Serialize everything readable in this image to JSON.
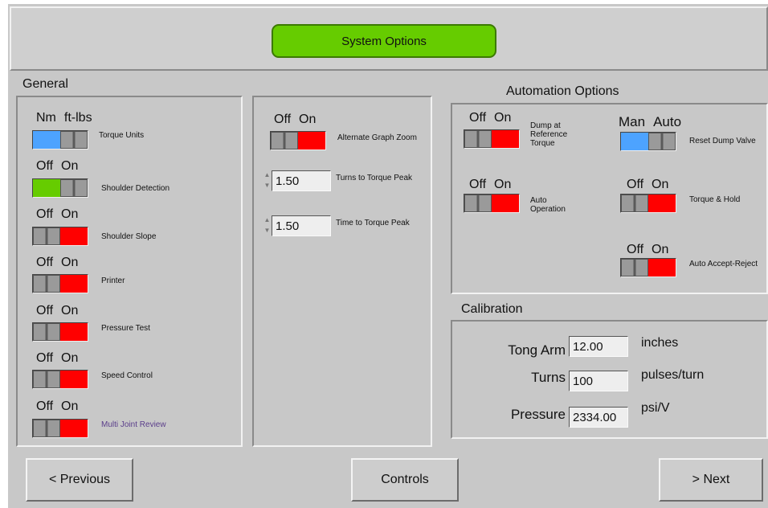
{
  "header": {
    "title": "System Options"
  },
  "general": {
    "label": "General",
    "items": [
      {
        "left": "Nm",
        "right": "ft-lbs",
        "desc": "Torque Units"
      },
      {
        "left": "Off",
        "right": "On",
        "desc": "Shoulder Detection"
      },
      {
        "left": "Off",
        "right": "On",
        "desc": "Shoulder Slope"
      },
      {
        "left": "Off",
        "right": "On",
        "desc": "Printer"
      },
      {
        "left": "Off",
        "right": "On",
        "desc": "Pressure Test"
      },
      {
        "left": "Off",
        "right": "On",
        "desc": "Speed Control"
      },
      {
        "left": "Off",
        "right": "On",
        "desc": "Multi Joint Review"
      }
    ]
  },
  "middle": {
    "zoom": {
      "left": "Off",
      "right": "On",
      "desc": "Alternate Graph Zoom"
    },
    "turns_to_torque_peak": {
      "value": "1.50",
      "label": "Turns to Torque Peak"
    },
    "time_to_torque_peak": {
      "value": "1.50",
      "label": "Time to Torque Peak"
    }
  },
  "automation": {
    "label": "Automation Options",
    "dump_at_reference": {
      "left": "Off",
      "right": "On",
      "desc": "Dump at Reference Torque"
    },
    "auto_operation": {
      "left": "Off",
      "right": "On",
      "desc": "Auto Operation"
    },
    "reset_dump_valve": {
      "left": "Man",
      "right": "Auto",
      "desc": "Reset Dump Valve"
    },
    "torque_hold": {
      "left": "Off",
      "right": "On",
      "desc": "Torque & Hold"
    },
    "auto_accept_reject": {
      "left": "Off",
      "right": "On",
      "desc": "Auto Accept-Reject"
    }
  },
  "calibration": {
    "label": "Calibration",
    "tong_arm": {
      "label": "Tong Arm",
      "value": "12.00",
      "unit": "inches"
    },
    "turns": {
      "label": "Turns",
      "value": "100",
      "unit": "pulses/turn"
    },
    "pressure": {
      "label": "Pressure",
      "value": "2334.00",
      "unit": "psi/V"
    }
  },
  "nav": {
    "previous": "<  Previous",
    "controls": "Controls",
    "next": ">  Next"
  },
  "colors": {
    "on_red": "#ff0000",
    "green": "#66cc00",
    "blue": "#4da3ff",
    "panel": "#c8c8c8"
  }
}
